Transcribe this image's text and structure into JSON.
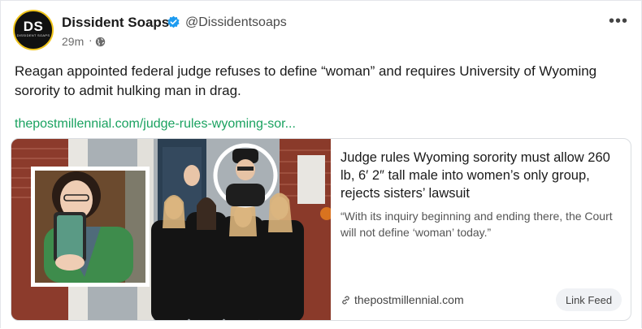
{
  "author": {
    "avatar_initials": "DS",
    "avatar_subtext": "DISSIDENT SOAPS",
    "name": "Dissident Soaps",
    "handle": "@Dissidentsoaps",
    "verified": true
  },
  "post": {
    "timestamp": "29m",
    "separator": "·",
    "visibility_icon": "globe-icon",
    "more_label": "•••",
    "text": "Reagan appointed federal judge refuses to define “woman” and requires University of Wyoming sorority to admit hulking man in drag.",
    "link_text": "thepostmillennial.com/judge-rules-wyoming-sor..."
  },
  "card": {
    "title": "Judge rules Wyoming sorority must allow 260 lb, 6′ 2″ tall male into women’s only group, rejects sisters’ lawsuit",
    "description": "“With its inquiry beginning and ending there, the Court will not define ‘woman’ today.”",
    "domain_icon": "link-icon",
    "domain": "thepostmillennial.com",
    "button_label": "Link Feed"
  },
  "colors": {
    "link": "#1aa260",
    "verified": "#1d9bf0",
    "avatar_ring": "#f0c419"
  }
}
